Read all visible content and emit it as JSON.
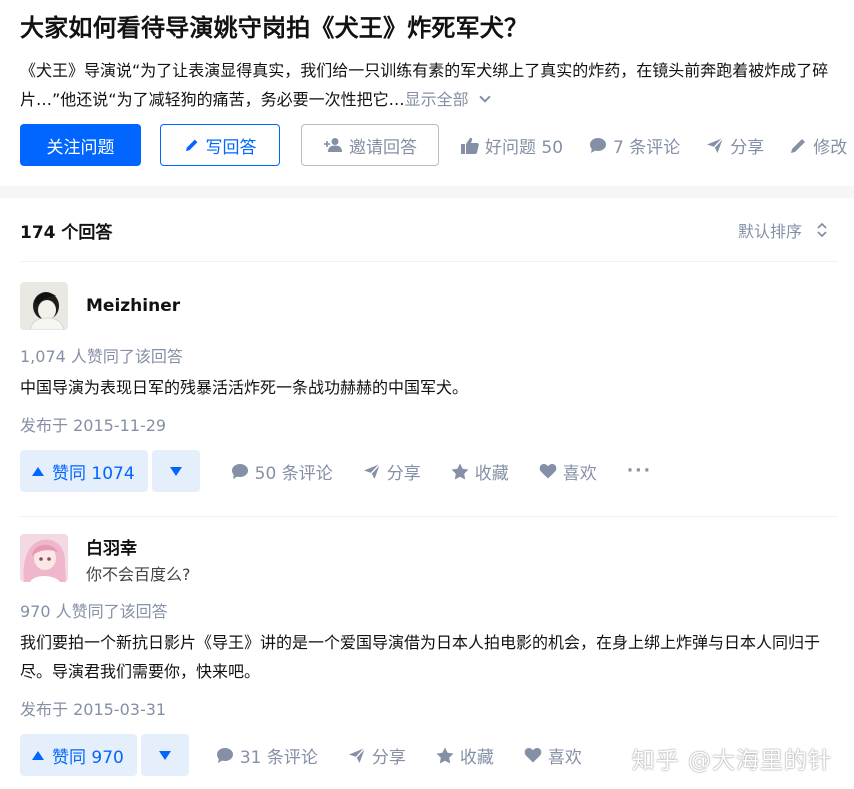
{
  "question": {
    "title": "大家如何看待导演姚守岗拍《犬王》炸死军犬？",
    "description": "《犬王》导演说“为了让表演显得真实，我们给一只训练有素的军犬绑上了真实的炸药，在镜头前奔跑着被炸成了碎片…”他还说“为了减轻狗的痛苦，务必要一次性把它…",
    "show_all": "显示全部",
    "follow_label": "关注问题",
    "write_label": "写回答",
    "invite_label": "邀请回答",
    "good_question_label": "好问题 50",
    "comments_label": "7 条评论",
    "share_label": "分享",
    "edit_label": "修改"
  },
  "answers_header": {
    "count_label": "174 个回答",
    "sort_label": "默认排序"
  },
  "answers": [
    {
      "author": "Meizhiner",
      "bio": "",
      "votes_text": "1,074 人赞同了该回答",
      "content": "中国导演为表现日军的残暴活活炸死一条战功赫赫的中国军犬。",
      "date": "发布于 2015-11-29",
      "upvote_label": "赞同 1074",
      "comments_label": "50 条评论",
      "share_label": "分享",
      "favorite_label": "收藏",
      "like_label": "喜欢",
      "more_label": "···"
    },
    {
      "author": "白羽幸",
      "bio": "你不会百度么?",
      "votes_text": "970 人赞同了该回答",
      "content": "我们要拍一个新抗日影片《导王》讲的是一个爱国导演借为日本人拍电影的机会，在身上绑上炸弹与日本人同归于尽。导演君我们需要你，快来吧。",
      "date": "发布于 2015-03-31",
      "upvote_label": "赞同 970",
      "comments_label": "31 条评论",
      "share_label": "分享",
      "favorite_label": "收藏",
      "like_label": "喜欢"
    }
  ],
  "watermark": "知乎 @大海里的针",
  "colors": {
    "brand": "#0066ff",
    "meta": "#8590a6",
    "vote_bg": "#e5effb"
  }
}
